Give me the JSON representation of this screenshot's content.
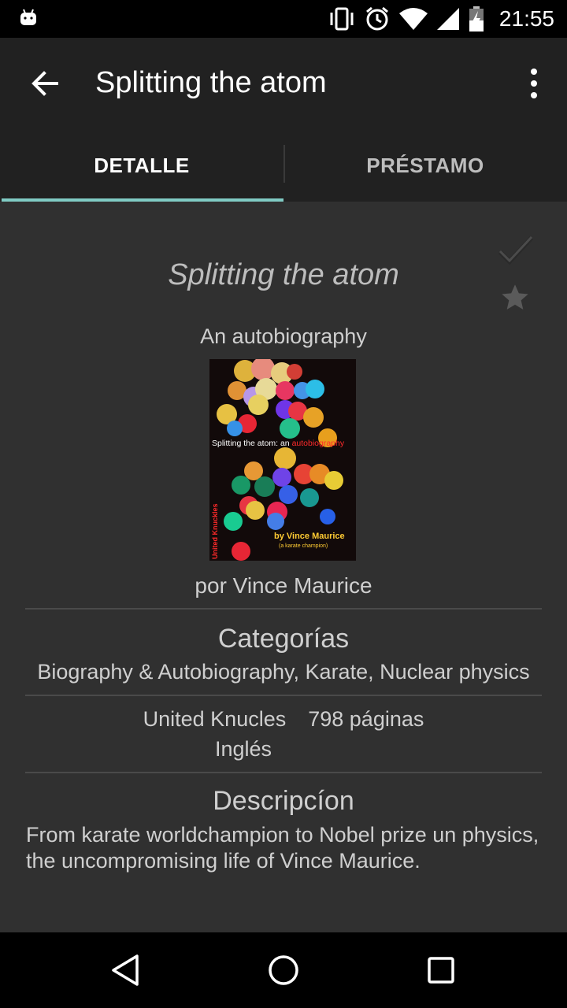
{
  "status_bar": {
    "time": "21:55"
  },
  "toolbar": {
    "title": "Splitting the atom"
  },
  "tabs": [
    {
      "label": "DETALLE",
      "selected": true
    },
    {
      "label": "PRÉSTAMO",
      "selected": false
    }
  ],
  "book": {
    "title": "Splitting the atom",
    "subtitle": "An autobiography",
    "author": "por Vince Maurice",
    "categories_heading": "Categorías",
    "categories": "Biography & Autobiography, Karate, Nuclear physics",
    "publisher": "United Knucles",
    "pages": "798 páginas",
    "language": "Inglés",
    "description_heading": "Descripcíon",
    "description": "From karate worldchampion to Nobel prize un physics, the uncompromising life of Vince Maurice."
  },
  "cover": {
    "title_white": "Splitting the atom: an ",
    "title_red": "autobiography",
    "by": "by Vince Maurice",
    "tagline": "(a karate champion)",
    "spine": "United Knuckles"
  },
  "colors": {
    "accent": "#80cbc4",
    "background": "#303030",
    "toolbar": "#212121"
  },
  "icons": [
    "back-arrow-icon",
    "more-vert-icon",
    "check-icon",
    "star-icon",
    "back-triangle-icon",
    "home-circle-icon",
    "recents-square-icon"
  ]
}
